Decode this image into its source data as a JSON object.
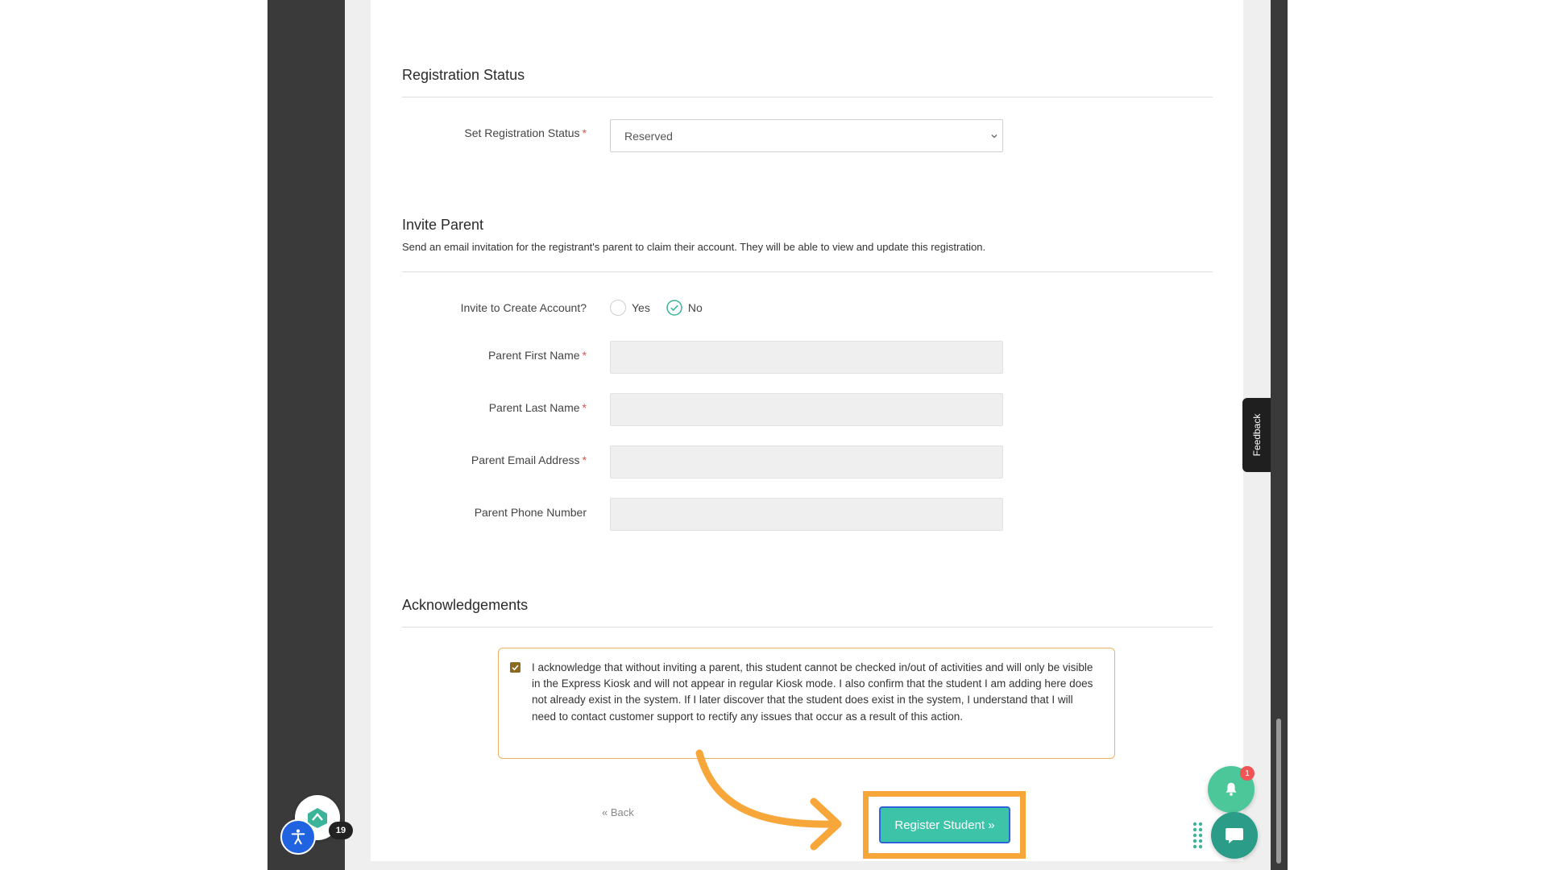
{
  "registration_status": {
    "section_title": "Registration Status",
    "field_label": "Set Registration Status",
    "required_mark": "*",
    "selected_value": "Reserved"
  },
  "invite_parent": {
    "section_title": "Invite Parent",
    "description": "Send an email invitation for the registrant's parent to claim their account. They will be able to view and update this registration.",
    "invite_label": "Invite to Create Account?",
    "options": [
      "Yes",
      "No"
    ],
    "selected_option": "No",
    "fields": [
      {
        "label": "Parent First Name",
        "required": true,
        "value": ""
      },
      {
        "label": "Parent Last Name",
        "required": true,
        "value": ""
      },
      {
        "label": "Parent Email Address",
        "required": true,
        "value": ""
      },
      {
        "label": "Parent Phone Number",
        "required": false,
        "value": ""
      }
    ]
  },
  "acknowledgements": {
    "section_title": "Acknowledgements",
    "checked": true,
    "text": "I acknowledge that without inviting a parent, this student cannot be checked in/out of activities and will only be visible in the Express Kiosk and will not appear in regular Kiosk mode. I also confirm that the student I am adding here does not already exist in the system. If I later discover that the student does exist in the system, I understand that I will need to contact customer support to rectify any issues that occur as a result of this action."
  },
  "actions": {
    "back_label": "« Back",
    "register_label": "Register Student »"
  },
  "widgets": {
    "feedback_label": "Feedback",
    "notification_count": "1",
    "app_badge_count": "19"
  },
  "colors": {
    "primary": "#3cc3a8",
    "highlight": "#f7a73a",
    "required": "#e05050",
    "ack_border": "#f0b060"
  }
}
